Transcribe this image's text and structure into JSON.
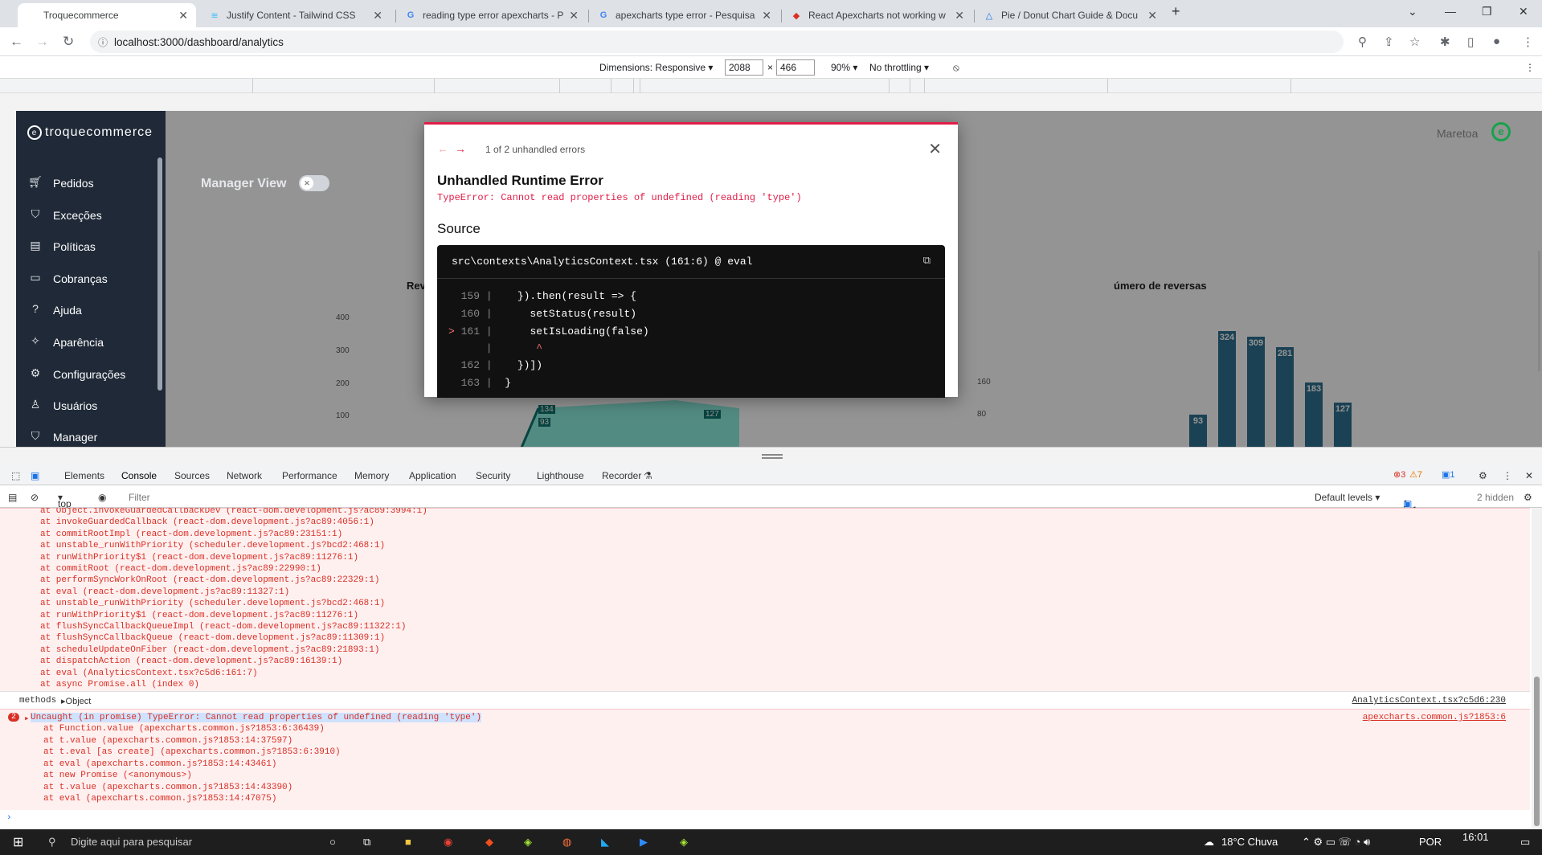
{
  "tabs": [
    {
      "label": "Troquecommerce",
      "icon": "page-icon"
    },
    {
      "label": "Justify Content - Tailwind CSS",
      "icon": "tailwind-icon"
    },
    {
      "label": "reading type error apexcharts - P",
      "icon": "google-icon"
    },
    {
      "label": "apexcharts type error - Pesquisa",
      "icon": "google-icon"
    },
    {
      "label": "React Apexcharts not working w",
      "icon": "apex-icon"
    },
    {
      "label": "Pie / Donut Chart Guide & Docu",
      "icon": "apex-icon"
    }
  ],
  "address": {
    "url": "localhost:3000/dashboard/analytics"
  },
  "device_toolbar": {
    "dimensions_label": "Dimensions: Responsive ▾",
    "width": "2088",
    "x": "×",
    "height": "466",
    "zoom": "90% ▾",
    "throttle": "No throttling ▾"
  },
  "app": {
    "brand": "troquecommerce",
    "user": "Maretoa",
    "manager_view": "Manager View",
    "sidebar": [
      {
        "label": "Pedidos",
        "icon": "cart-icon"
      },
      {
        "label": "Exceções",
        "icon": "shield-icon"
      },
      {
        "label": "Políticas",
        "icon": "document-icon"
      },
      {
        "label": "Cobranças",
        "icon": "card-icon"
      },
      {
        "label": "Ajuda",
        "icon": "help-icon"
      },
      {
        "label": "Aparência",
        "icon": "sparkle-icon"
      },
      {
        "label": "Configurações",
        "icon": "gear-icon"
      },
      {
        "label": "Usuários",
        "icon": "user-icon"
      },
      {
        "label": "Manager",
        "icon": "shield-icon"
      }
    ],
    "left_chart": {
      "title_fragment": "Rev",
      "y_ticks": [
        "400",
        "300",
        "200",
        "100"
      ],
      "labels": [
        "134",
        "93",
        "127"
      ]
    },
    "right_chart": {
      "title_fragment": "úmero de reversas",
      "y_ticks": [
        "160",
        "80"
      ],
      "values": [
        93,
        324,
        309,
        281,
        183,
        127
      ]
    }
  },
  "error_modal": {
    "count": "1 of 2 unhandled errors",
    "title": "Unhandled Runtime Error",
    "message": "TypeError: Cannot read properties of undefined (reading 'type')",
    "source_heading": "Source",
    "file": "src\\contexts\\AnalyticsContext.tsx (161:6) @ eval",
    "code": [
      {
        "n": "159",
        "t": "    }).then(result => {"
      },
      {
        "n": "160",
        "t": "      setStatus(result)"
      },
      {
        "n": "161",
        "t": "      setIsLoading(false)"
      },
      {
        "n": "",
        "t": "       ^"
      },
      {
        "n": "162",
        "t": "    })])"
      },
      {
        "n": "163",
        "t": "  }"
      }
    ]
  },
  "devtools": {
    "tabs": [
      "Elements",
      "Console",
      "Sources",
      "Network",
      "Performance",
      "Memory",
      "Application",
      "Security",
      "Lighthouse",
      "Recorder"
    ],
    "errors": "3",
    "warnings": "7",
    "info": "1",
    "context": "top",
    "filter_placeholder": "Filter",
    "levels": "Default levels ▾",
    "issues": "1 Issue:",
    "issues_count": "1",
    "hidden": "2 hidden"
  },
  "console": {
    "trace1": [
      "at Object.invokeGuardedCallbackDev (react-dom.development.js?ac89:3994:1)",
      "at invokeGuardedCallback (react-dom.development.js?ac89:4056:1)",
      "at commitRootImpl (react-dom.development.js?ac89:23151:1)",
      "at unstable_runWithPriority (scheduler.development.js?bcd2:468:1)",
      "at runWithPriority$1 (react-dom.development.js?ac89:11276:1)",
      "at commitRoot (react-dom.development.js?ac89:22990:1)",
      "at performSyncWorkOnRoot (react-dom.development.js?ac89:22329:1)",
      "at eval (react-dom.development.js?ac89:11327:1)",
      "at unstable_runWithPriority (scheduler.development.js?bcd2:468:1)",
      "at runWithPriority$1 (react-dom.development.js?ac89:11276:1)",
      "at flushSyncCallbackQueueImpl (react-dom.development.js?ac89:11322:1)",
      "at flushSyncCallbackQueue (react-dom.development.js?ac89:11309:1)",
      "at scheduleUpdateOnFiber (react-dom.development.js?ac89:21893:1)",
      "at dispatchAction (react-dom.development.js?ac89:16139:1)",
      "at eval (AnalyticsContext.tsx?c5d6:161:7)",
      "at async Promise.all (index 0)"
    ],
    "methods_label": "methods",
    "methods_value": "▸Object",
    "methods_src": "AnalyticsContext.tsx?c5d6:230",
    "err_count": "2",
    "err_msg": "Uncaught (in promise) TypeError: Cannot read properties of undefined (reading 'type')",
    "err_src": "apexcharts.common.js?1853:6",
    "trace2": [
      "at Function.value (apexcharts.common.js?1853:6:36439)",
      "at t.value (apexcharts.common.js?1853:14:37597)",
      "at t.eval [as create] (apexcharts.common.js?1853:6:3910)",
      "at eval (apexcharts.common.js?1853:14:43461)",
      "at new Promise (<anonymous>)",
      "at t.value (apexcharts.common.js?1853:14:43390)",
      "at eval (apexcharts.common.js?1853:14:47075)"
    ]
  },
  "taskbar": {
    "search": "Digite aqui para pesquisar",
    "weather": "18°C Chuva",
    "lang": "POR",
    "time": "16:01"
  }
}
